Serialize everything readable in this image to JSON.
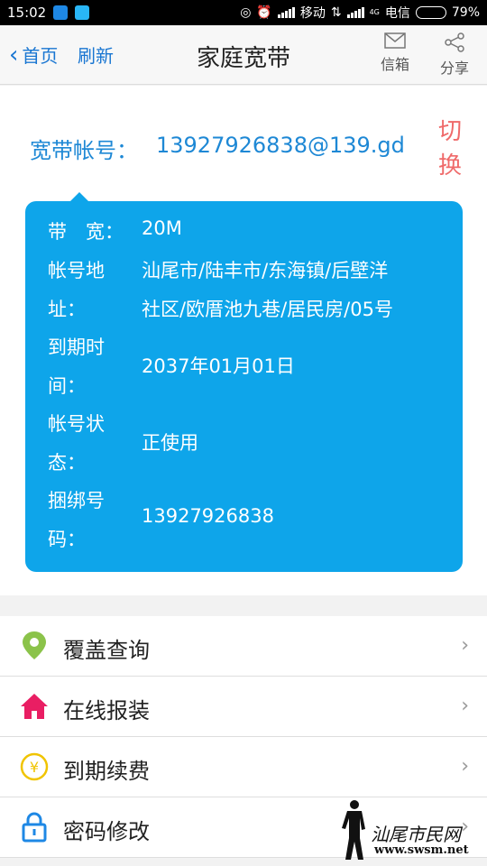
{
  "status_bar": {
    "time": "15:02",
    "carrier1": "移动",
    "carrier2": "电信",
    "network_tag": "4G",
    "battery": "79%",
    "battery_level": 0.79
  },
  "nav": {
    "back_label": "首页",
    "refresh_label": "刷新",
    "title": "家庭宽带",
    "mail_label": "信箱",
    "share_label": "分享"
  },
  "account": {
    "label": "宽带帐号：",
    "value": "13927926838@139.gd",
    "switch_line1": "切",
    "switch_line2": "换"
  },
  "info": {
    "bandwidth_label": "带　宽：",
    "bandwidth_value": "20M",
    "address_label_1": "帐号地",
    "address_label_2": "址：",
    "address_value_1": "汕尾市/陆丰市/东海镇/后壁洋",
    "address_value_2": "社区/欧厝池九巷/居民房/05号",
    "expiry_label_1": "到期时",
    "expiry_label_2": "间：",
    "expiry_value": "2037年01月01日",
    "status_label_1": "帐号状",
    "status_label_2": "态：",
    "status_value": "正使用",
    "binding_label_1": "捆绑号",
    "binding_label_2": "码：",
    "binding_value": "13927926838"
  },
  "menu": {
    "items": [
      {
        "label": "覆盖查询",
        "icon": "location-pin-icon",
        "color": "#8bc34a"
      },
      {
        "label": "在线报装",
        "icon": "home-icon",
        "color": "#e91e63"
      },
      {
        "label": "到期续费",
        "icon": "yen-coin-icon",
        "color": "#f0c400"
      },
      {
        "label": "密码修改",
        "icon": "lock-icon",
        "color": "#1e88e5"
      }
    ]
  },
  "watermark": {
    "name": "汕尾市民网",
    "url": "www.swsm.net"
  }
}
